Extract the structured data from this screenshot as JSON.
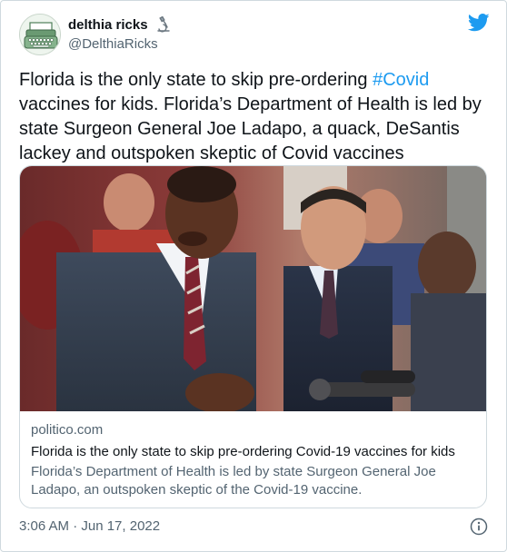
{
  "author": {
    "display_name": "delthia ricks",
    "handle": "@DelthiaRicks"
  },
  "tweet": {
    "text_before": "Florida is the only state to skip pre-ordering ",
    "hashtag": "#Covid",
    "text_after": " vaccines for kids. Florida’s Department of Health is led by state Surgeon General Joe Ladapo, a quack, DeSantis lackey and outspoken skeptic of Covid vaccines",
    "timestamp": "3:06 AM · Jun 17, 2022"
  },
  "card": {
    "domain": "politico.com",
    "title": "Florida is the only state to skip pre-ordering Covid-19 vaccines for kids",
    "description": "Florida’s Department of Health is led by state Surgeon General Joe Ladapo, an outspoken skeptic of the Covid-19 vaccine."
  },
  "icons": {
    "brand": "twitter-bird-icon",
    "badge": "microscope-icon",
    "info": "info-icon"
  },
  "colors": {
    "accent": "#1d9bf0",
    "text": "#0f1419",
    "secondary": "#536471",
    "border": "#cfd9de"
  }
}
